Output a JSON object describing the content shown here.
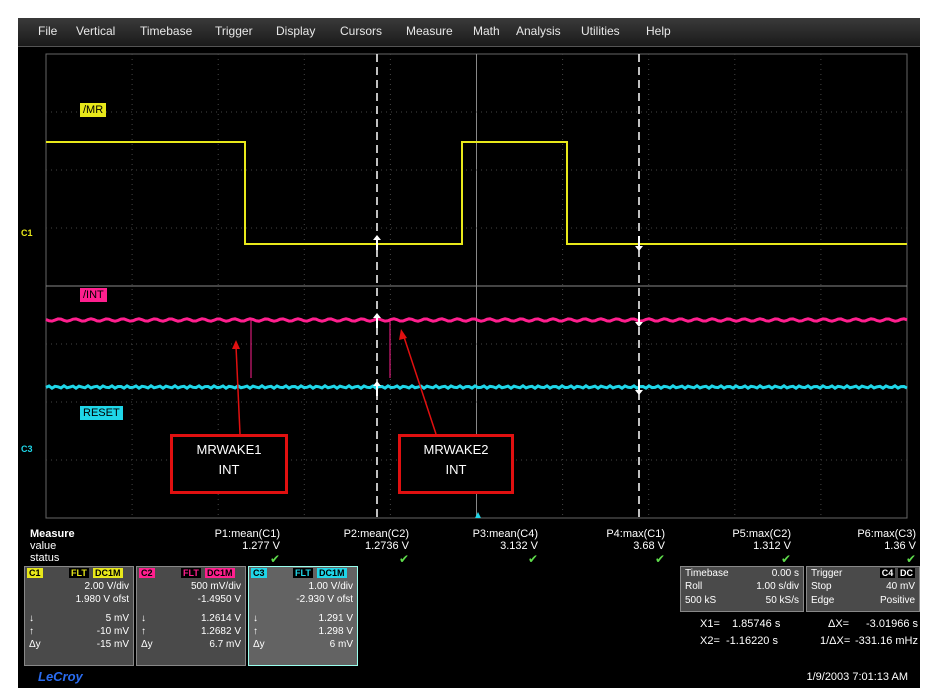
{
  "menu": [
    "File",
    "Vertical",
    "Timebase",
    "Trigger",
    "Display",
    "Cursors",
    "Measure",
    "Math",
    "Analysis",
    "Utilities",
    "Help"
  ],
  "traces": {
    "c1_label": "/MR",
    "c2_label": "/INT",
    "c3_label": "RESET",
    "c1_marker": "C1",
    "c3_marker": "C3",
    "colors": {
      "c1": "#e8e81a",
      "c2": "#ff1f8e",
      "c3": "#1fd6e8"
    }
  },
  "callouts": {
    "first": [
      "MRWAKE1",
      "INT"
    ],
    "second": [
      "MRWAKE2",
      "INT"
    ]
  },
  "measure": {
    "title": "Measure",
    "row_value": "value",
    "row_status": "status",
    "params": [
      {
        "name": "P1:mean(C1)",
        "value": "1.277 V"
      },
      {
        "name": "P2:mean(C2)",
        "value": "1.2736 V"
      },
      {
        "name": "P3:mean(C4)",
        "value": "3.132 V"
      },
      {
        "name": "P4:max(C1)",
        "value": "3.68 V"
      },
      {
        "name": "P5:max(C2)",
        "value": "1.312 V"
      },
      {
        "name": "P6:max(C3)",
        "value": "1.36 V"
      }
    ],
    "check": "✔"
  },
  "channels": [
    {
      "id": "C1",
      "flt": "FLT",
      "coupling": "DC1M",
      "vdiv": "2.00 V/div",
      "ofst": "1.980 V ofst",
      "low": "5 mV",
      "high": "-10 mV",
      "dy": "-15 mV",
      "color": "#e8e81a"
    },
    {
      "id": "C2",
      "flt": "FLT",
      "coupling": "DC1M",
      "vdiv": "500 mV/div",
      "ofst": "-1.4950 V",
      "low": "1.2614 V",
      "high": "1.2682 V",
      "dy": "6.7 mV",
      "color": "#ff1f8e"
    },
    {
      "id": "C3",
      "flt": "FLT",
      "coupling": "DC1M",
      "vdiv": "1.00 V/div",
      "ofst": "-2.930 V ofst",
      "low": "1.291 V",
      "high": "1.298 V",
      "dy": "6 mV",
      "color": "#1fd6e8"
    }
  ],
  "symbols": {
    "low": "↓",
    "high": "↑",
    "dy": "Δy"
  },
  "timebase": {
    "title": "Timebase",
    "delay": "0.00 s",
    "mode": "Roll",
    "tdiv": "1.00 s/div",
    "samples": "500 kS",
    "rate": "50 kS/s"
  },
  "trigger": {
    "title": "Trigger",
    "source_tag": "C4",
    "coupling_tag": "DC",
    "mode": "Stop",
    "level": "40 mV",
    "type": "Edge",
    "slope": "Positive"
  },
  "cursors": {
    "x1_label": "X1=",
    "x1": "1.85746 s",
    "dx_label": "ΔX=",
    "dx": "-3.01966 s",
    "x2_label": "X2=",
    "x2": "-1.16220 s",
    "inv_label": "1/ΔX=",
    "inv": "-331.16 mHz"
  },
  "footer": {
    "brand": "LeCroy",
    "datetime": "1/9/2003 7:01:13 AM"
  }
}
